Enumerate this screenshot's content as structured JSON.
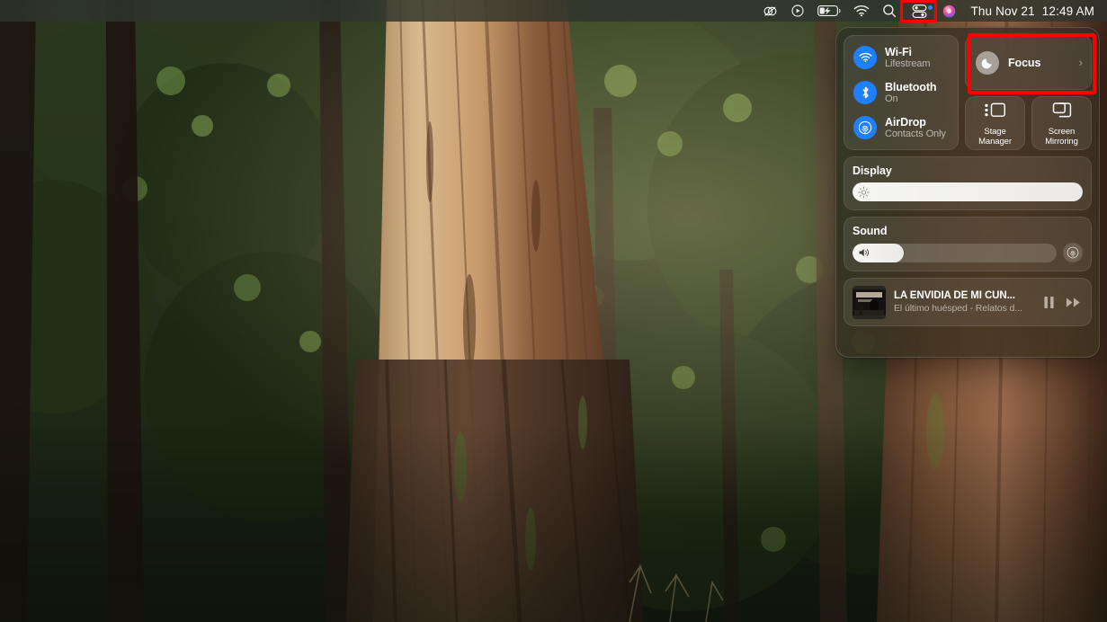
{
  "menubar": {
    "icons": [
      {
        "name": "creative-cloud-icon",
        "glyph": "cc"
      },
      {
        "name": "play-circle-icon",
        "glyph": "play"
      },
      {
        "name": "battery-charging-icon",
        "glyph": "battery"
      },
      {
        "name": "wifi-menu-icon",
        "glyph": "wifi"
      },
      {
        "name": "spotlight-search-icon",
        "glyph": "search"
      },
      {
        "name": "control-center-icon",
        "glyph": "controlcenter"
      },
      {
        "name": "siri-icon",
        "glyph": "siri"
      }
    ],
    "date": "Thu Nov 21",
    "time": "12:49 AM"
  },
  "control_center": {
    "connectivity": [
      {
        "label": "Wi-Fi",
        "status": "Lifestream",
        "icon": "wifi-icon",
        "accent": "#1f80ff"
      },
      {
        "label": "Bluetooth",
        "status": "On",
        "icon": "bluetooth-icon",
        "accent": "#1f80ff"
      },
      {
        "label": "AirDrop",
        "status": "Contacts Only",
        "icon": "airdrop-icon",
        "accent": "#1f80ff"
      }
    ],
    "focus": {
      "label": "Focus",
      "icon": "moon-icon",
      "chevron": "›",
      "highlight_color": "#ff0000"
    },
    "tiles": [
      {
        "label_line1": "Stage",
        "label_line2": "Manager",
        "icon": "stage-manager-icon"
      },
      {
        "label_line1": "Screen",
        "label_line2": "Mirroring",
        "icon": "screen-mirroring-icon"
      }
    ],
    "display": {
      "title": "Display",
      "icon": "brightness-icon",
      "value_percent": 100
    },
    "sound": {
      "title": "Sound",
      "icon": "speaker-icon",
      "value_percent": 25,
      "output_icon": "airplay-audio-icon"
    },
    "now_playing": {
      "title": "LA ENVIDIA DE MI CUÑ...",
      "subtitle": "El último huésped - Relatos d...",
      "artwork_name": "podcast-artwork",
      "pause_icon": "pause-icon",
      "forward_icon": "fast-forward-icon"
    }
  }
}
